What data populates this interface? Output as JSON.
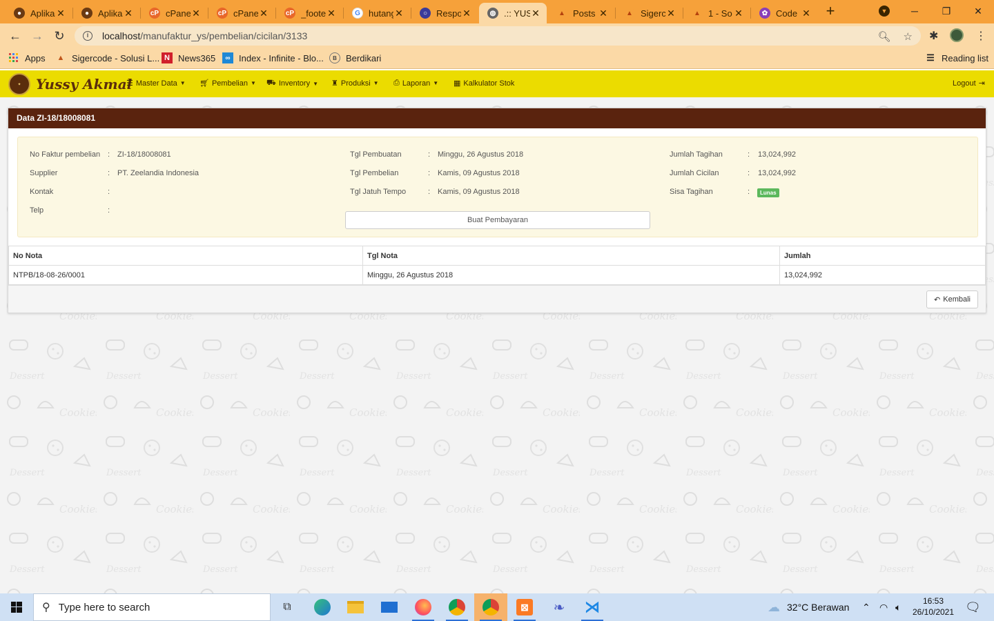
{
  "browser": {
    "tabs": [
      {
        "label": "Aplikas",
        "icon": "cake-icon"
      },
      {
        "label": "Aplikas",
        "icon": "cake-icon"
      },
      {
        "label": "cPanel",
        "icon": "cpanel-icon"
      },
      {
        "label": "cPanel",
        "icon": "cpanel-icon"
      },
      {
        "label": "_foote",
        "icon": "cpanel-icon"
      },
      {
        "label": "hutang",
        "icon": "google-icon"
      },
      {
        "label": "Respo",
        "icon": "circle-icon"
      },
      {
        "label": ".:: YUS",
        "icon": "globe-icon",
        "active": true
      },
      {
        "label": "Posts",
        "icon": "sigercode-icon"
      },
      {
        "label": "Sigerc",
        "icon": "sigercode-icon"
      },
      {
        "label": "1 - So",
        "icon": "sigercode-icon"
      },
      {
        "label": "Code",
        "icon": "code-icon"
      }
    ],
    "url_host": "localhost",
    "url_path": "/manufaktur_ys/pembelian/cicilan/3133",
    "bookmarks": [
      {
        "label": "Apps",
        "icon": "apps-grid-icon"
      },
      {
        "label": "Sigercode - Solusi L...",
        "icon": "sigercode-icon"
      },
      {
        "label": "News365",
        "icon": "news365-icon"
      },
      {
        "label": "Index - Infinite - Blo...",
        "icon": "infinite-icon"
      },
      {
        "label": "Berdikari",
        "icon": "berdikari-icon"
      }
    ],
    "reading_list": "Reading list"
  },
  "app": {
    "brand": "Yussy Akmal",
    "menu": [
      {
        "label": "Master Data",
        "icon": "list-icon"
      },
      {
        "label": "Pembelian",
        "icon": "cart-icon"
      },
      {
        "label": "Inventory",
        "icon": "truck-icon"
      },
      {
        "label": "Produksi",
        "icon": "factory-icon"
      },
      {
        "label": "Laporan",
        "icon": "report-icon"
      },
      {
        "label": "Kalkulator Stok",
        "icon": "calculator-icon"
      }
    ],
    "logout": "Logout"
  },
  "panel": {
    "title": "Data ZI-18/18008081",
    "col1": [
      {
        "label": "No Faktur pembelian",
        "sep": ":",
        "value": "ZI-18/18008081"
      },
      {
        "label": "Supplier",
        "sep": ":",
        "value": "PT. Zeelandia Indonesia"
      },
      {
        "label": "Kontak",
        "sep": ":",
        "value": ""
      },
      {
        "label": "Telp",
        "sep": ":",
        "value": ""
      }
    ],
    "col2": [
      {
        "label": "Tgl Pembuatan",
        "sep": ":",
        "value": "Minggu, 26 Agustus 2018"
      },
      {
        "label": "Tgl Pembelian",
        "sep": ":",
        "value": "Kamis, 09 Agustus 2018"
      },
      {
        "label": "Tgl Jatuh Tempo",
        "sep": ":",
        "value": "Kamis, 09 Agustus 2018"
      }
    ],
    "col3": [
      {
        "label": "Jumlah Tagihan",
        "sep": ":",
        "value": "13,024,992"
      },
      {
        "label": "Jumlah Cicilan",
        "sep": ":",
        "value": "13,024,992"
      },
      {
        "label": "Sisa Tagihan",
        "sep": ":",
        "value": ""
      }
    ],
    "status_badge": "Lunas",
    "pay_button": "Buat Pembayaran",
    "table": {
      "headers": [
        "No Nota",
        "Tgl Nota",
        "Jumlah"
      ],
      "rows": [
        [
          "NTPB/18-08-26/0001",
          "Minggu, 26 Agustus 2018",
          "13,024,992"
        ]
      ]
    },
    "back_button": "Kembali"
  },
  "taskbar": {
    "search_placeholder": "Type here to search",
    "weather": "32°C  Berawan",
    "time": "16:53",
    "date": "26/10/2021"
  },
  "colors": {
    "tab_strip": "#f6a13a",
    "toolbar": "#fbd9a6",
    "app_navbar": "#ebdc00",
    "panel_header": "#5a230e",
    "info_box": "#fcf8e3",
    "badge_success": "#5cb85c"
  }
}
